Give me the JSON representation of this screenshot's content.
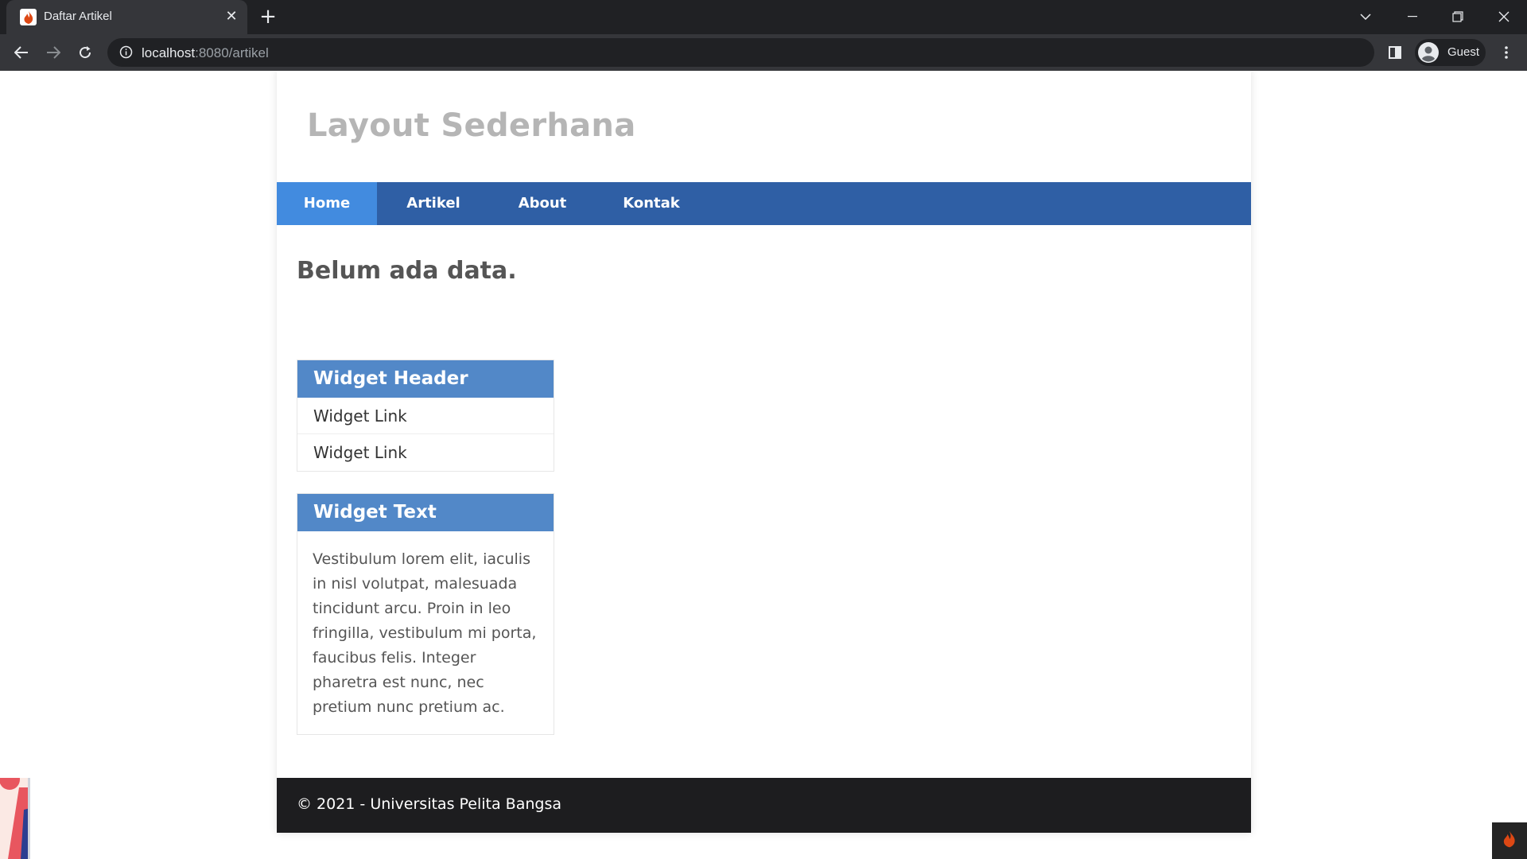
{
  "browser": {
    "tab_title": "Daftar Artikel",
    "url_host": "localhost",
    "url_rest": ":8080/artikel",
    "profile_label": "Guest"
  },
  "page": {
    "site_title": "Layout Sederhana",
    "nav": [
      {
        "label": "Home",
        "active": true
      },
      {
        "label": "Artikel",
        "active": false
      },
      {
        "label": "About",
        "active": false
      },
      {
        "label": "Kontak",
        "active": false
      }
    ],
    "empty_message": "Belum ada data.",
    "widgets": {
      "links_header": "Widget Header",
      "links": [
        "Widget Link",
        "Widget Link"
      ],
      "text_header": "Widget Text",
      "text_body": "Vestibulum lorem elit, iaculis in nisl volutpat, malesuada tincidunt arcu. Proin in leo fringilla, vestibulum mi porta, faucibus felis. Integer pharetra est nunc, nec pretium nunc pretium ac."
    },
    "footer_text": "© 2021 - Universitas Pelita Bangsa"
  },
  "colors": {
    "nav_bg": "#2f5fa5",
    "nav_active_bg": "#428bdf",
    "widget_header_bg": "#5288c8",
    "footer_bg": "#1d1d1f",
    "title_color": "#b5b5b5"
  },
  "icons": {
    "favicon": "codeigniter-flame-icon",
    "close": "close-icon",
    "new_tab": "plus-icon",
    "back": "arrow-left-icon",
    "forward": "arrow-right-icon",
    "reload": "reload-icon",
    "site_info": "info-icon",
    "side_panel": "side-panel-icon",
    "profile": "profile-icon",
    "menu": "kebab-menu-icon",
    "debug_toolbar": "codeigniter-flame-icon"
  }
}
